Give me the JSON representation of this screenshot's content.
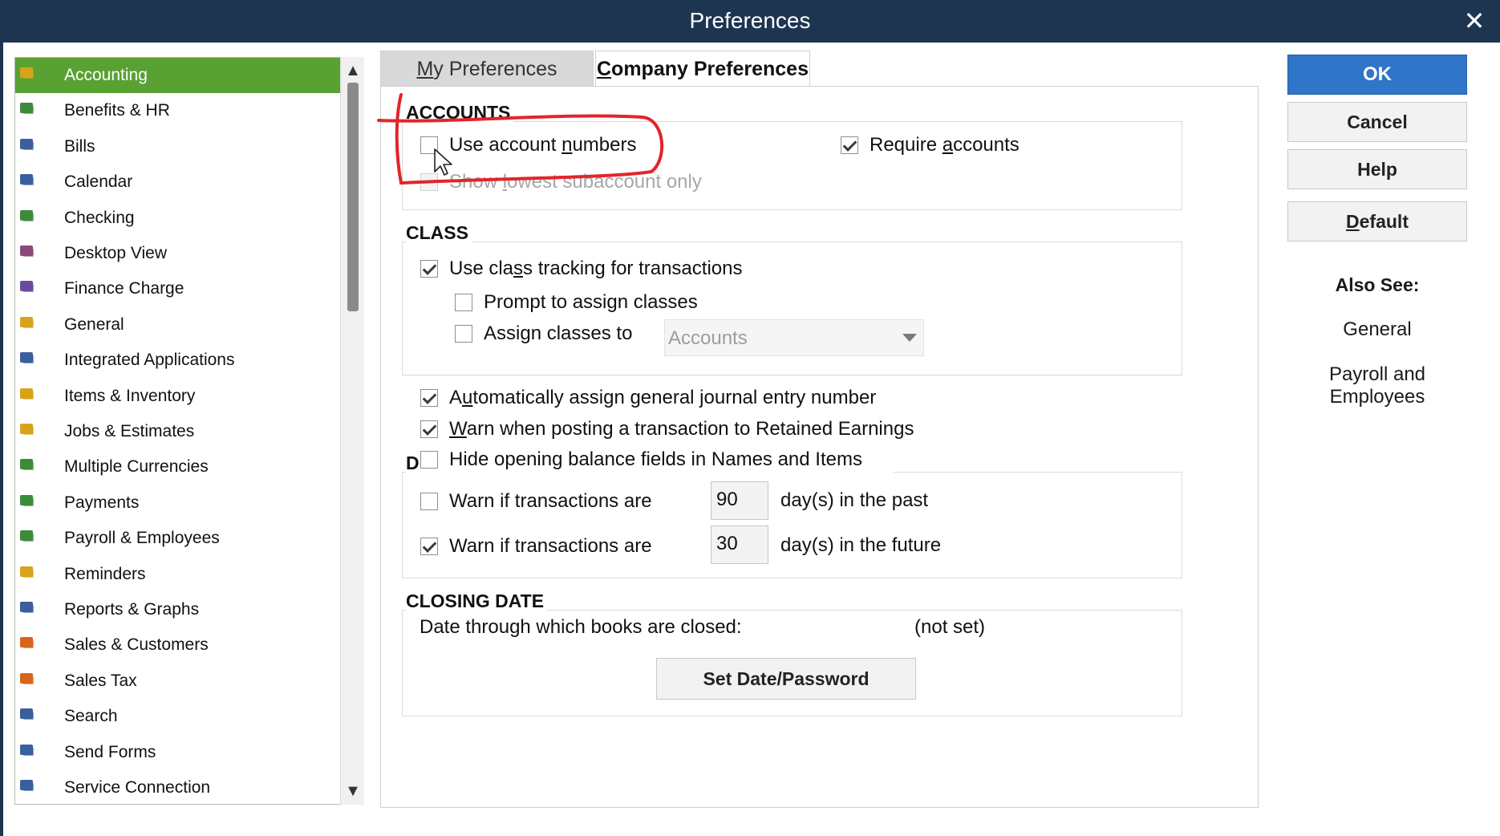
{
  "window": {
    "title": "Preferences",
    "close_glyph": "✕"
  },
  "colors": {
    "titlebar": "#1d3550",
    "selected": "#5aa133",
    "ok_button": "#2f75c8",
    "annotation": "#e2252b"
  },
  "sidebar": {
    "items": [
      {
        "label": "Accounting",
        "icon": "accounting-icon",
        "selected": true
      },
      {
        "label": "Benefits & HR",
        "icon": "benefits-icon"
      },
      {
        "label": "Bills",
        "icon": "bills-icon"
      },
      {
        "label": "Calendar",
        "icon": "calendar-icon"
      },
      {
        "label": "Checking",
        "icon": "checking-icon"
      },
      {
        "label": "Desktop View",
        "icon": "desktop-view-icon"
      },
      {
        "label": "Finance Charge",
        "icon": "finance-charge-icon"
      },
      {
        "label": "General",
        "icon": "general-icon"
      },
      {
        "label": "Integrated Applications",
        "icon": "integrated-apps-icon"
      },
      {
        "label": "Items & Inventory",
        "icon": "items-inventory-icon"
      },
      {
        "label": "Jobs & Estimates",
        "icon": "jobs-estimates-icon"
      },
      {
        "label": "Multiple Currencies",
        "icon": "currencies-icon"
      },
      {
        "label": "Payments",
        "icon": "payments-icon"
      },
      {
        "label": "Payroll & Employees",
        "icon": "payroll-icon"
      },
      {
        "label": "Reminders",
        "icon": "reminders-icon"
      },
      {
        "label": "Reports & Graphs",
        "icon": "reports-icon"
      },
      {
        "label": "Sales & Customers",
        "icon": "sales-customers-icon"
      },
      {
        "label": "Sales Tax",
        "icon": "sales-tax-icon"
      },
      {
        "label": "Search",
        "icon": "search-icon"
      },
      {
        "label": "Send Forms",
        "icon": "send-forms-icon"
      },
      {
        "label": "Service Connection",
        "icon": "service-connection-icon"
      }
    ]
  },
  "tabs": {
    "my_prefix": "M",
    "my_rest": "y Preferences",
    "company_prefix": "C",
    "company_rest": "ompany Preferences"
  },
  "accounts": {
    "title": "ACCOUNTS",
    "use_numbers_a": "Use account ",
    "use_numbers_u": "n",
    "use_numbers_b": "umbers",
    "show_lowest_a": "Show ",
    "show_lowest_u": "l",
    "show_lowest_b": "owest subaccount only",
    "require_a": "Require ",
    "require_u": "a",
    "require_b": "ccounts"
  },
  "class": {
    "title": "CLASS",
    "tracking_a": "Use cla",
    "tracking_u": "s",
    "tracking_b": "s tracking for transactions",
    "prompt": "Prompt to assign classes",
    "assign_a": "Assign classes to",
    "assign_select": "Accounts"
  },
  "misc": {
    "auto_a": "A",
    "auto_u": "u",
    "auto_b": "tomatically assign general journal entry number",
    "warn_re_u": "W",
    "warn_re_b": "arn when posting a transaction to Retained Earnings",
    "hide_opening": "Hide opening balance fields in Names and Items",
    "date_letter": "D",
    "warn_past": "Warn if transactions are",
    "past_value": "90",
    "past_suffix": "day(s) in the past",
    "warn_future": "Warn if transactions are",
    "future_value": "30",
    "future_suffix": "day(s) in the future"
  },
  "closing": {
    "title": "CLOSING DATE",
    "label": "Date through which books are closed:",
    "value": "(not set)",
    "set_button": "Set Date/Password"
  },
  "buttons": {
    "ok": "OK",
    "cancel": "Cancel",
    "help": "Help",
    "default_u": "D",
    "default_rest": "efault"
  },
  "also_see": {
    "title": "Also See:",
    "links": [
      "General",
      "Payroll and",
      "Employees"
    ]
  }
}
